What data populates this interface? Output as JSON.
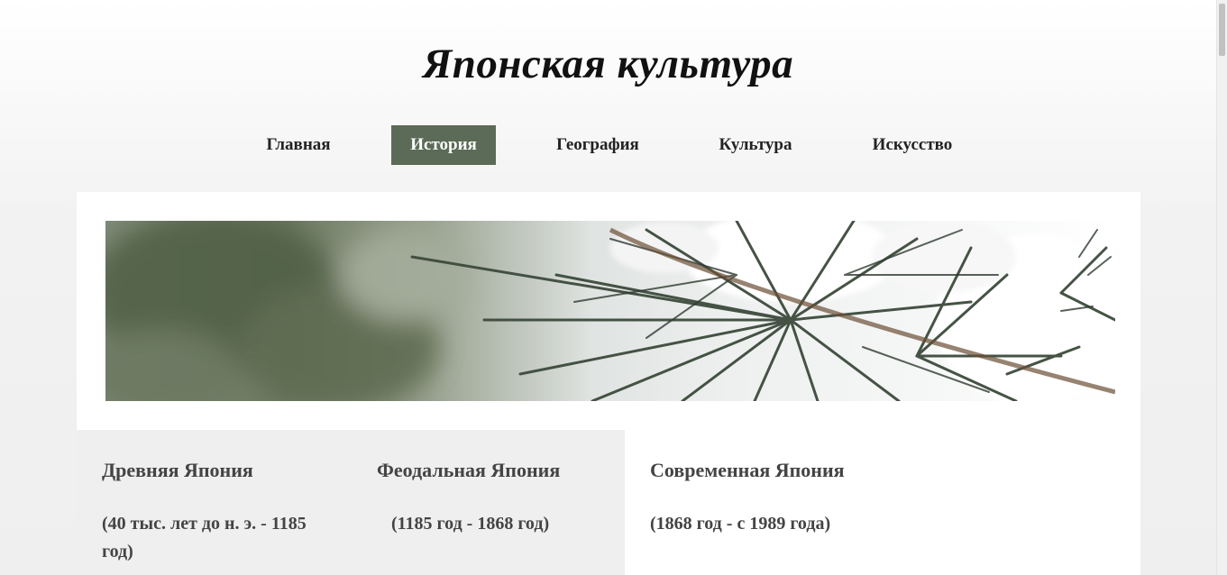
{
  "site": {
    "title": "Японская культура"
  },
  "nav": {
    "items": [
      {
        "label": "Главная",
        "active": false
      },
      {
        "label": "История",
        "active": true
      },
      {
        "label": "География",
        "active": false
      },
      {
        "label": "Культура",
        "active": false
      },
      {
        "label": "Искусство",
        "active": false
      }
    ],
    "active_color": "#5b6b57"
  },
  "banner": {
    "description_icon": "snowy-pine-branch-image"
  },
  "eras": [
    {
      "title": "Древняя Япония",
      "dates": "(40 тыс. лет до н. э. - 1185 год)"
    },
    {
      "title": "Феодальная Япония",
      "dates": "(1185 год - 1868 год)"
    },
    {
      "title": "Современная Япония",
      "dates": "(1868 год - с 1989 года)"
    }
  ],
  "colors": {
    "heading_text": "#444444",
    "left_column_bg": "#efefef"
  }
}
